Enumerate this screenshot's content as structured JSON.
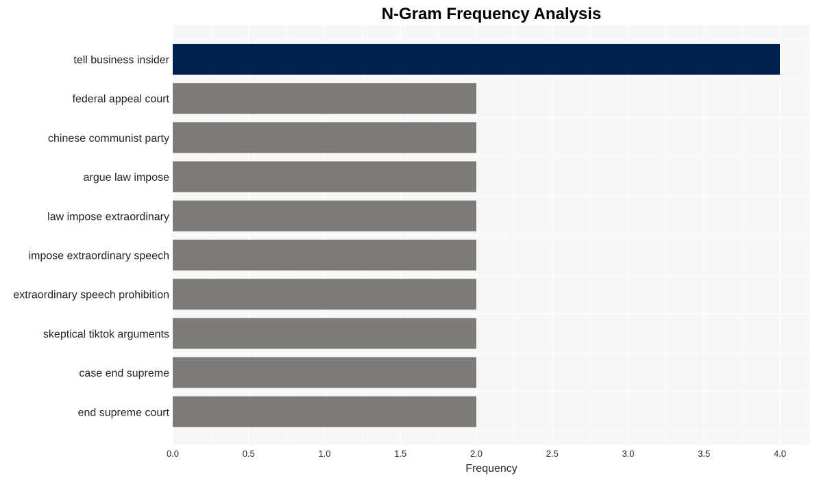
{
  "chart_data": {
    "type": "bar",
    "orientation": "horizontal",
    "title": "N-Gram Frequency Analysis",
    "xlabel": "Frequency",
    "ylabel": "",
    "categories": [
      "tell business insider",
      "federal appeal court",
      "chinese communist party",
      "argue law impose",
      "law impose extraordinary",
      "impose extraordinary speech",
      "extraordinary speech prohibition",
      "skeptical tiktok arguments",
      "case end supreme",
      "end supreme court"
    ],
    "values": [
      4,
      2,
      2,
      2,
      2,
      2,
      2,
      2,
      2,
      2
    ],
    "xlim": [
      0,
      4.2
    ],
    "xticks": [
      0.0,
      0.5,
      1.0,
      1.5,
      2.0,
      2.5,
      3.0,
      3.5,
      4.0
    ],
    "xtick_labels": [
      "0.0",
      "0.5",
      "1.0",
      "1.5",
      "2.0",
      "2.5",
      "3.0",
      "3.5",
      "4.0"
    ],
    "grid": true,
    "colors": {
      "highlight": "#00214d",
      "default": "#7c7b78",
      "plot_background": "#f7f7f7",
      "grid": "#ffffff"
    }
  }
}
